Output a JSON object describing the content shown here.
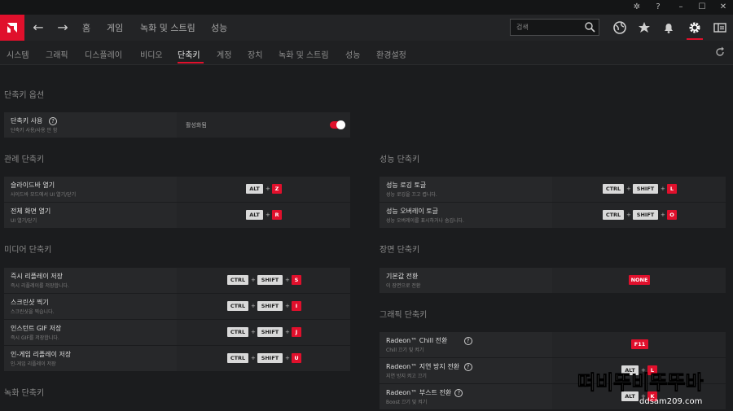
{
  "colors": {
    "accent": "#e0102c",
    "background": "#1b1c1e",
    "row": "#242527"
  },
  "titlebar": {
    "icons": [
      "minimize-icon",
      "help-icon",
      "maximize-icon",
      "close-icon"
    ]
  },
  "topnav": {
    "items": [
      "홈",
      "게임",
      "녹화 및 스트림",
      "성능"
    ],
    "search_placeholder": "검색"
  },
  "subnav": {
    "tabs": [
      "시스템",
      "그래픽",
      "디스플레이",
      "비디오",
      "단축키",
      "계정",
      "장치",
      "녹화 및 스트림",
      "성능",
      "환경설정"
    ],
    "active": "단축키"
  },
  "options": {
    "title": "단축키 옵션",
    "hotkey": {
      "title": "단축키 사용",
      "desc": "단축키 사용/사용 안 함",
      "state": "활성화됨"
    }
  },
  "left_sections": [
    {
      "title": "관례 단축키",
      "rows": [
        {
          "title": "슬라이드바 열기",
          "desc": "사이드바 모드에서 UI 열기/닫기",
          "keys": [
            "ALT",
            "Z"
          ]
        },
        {
          "title": "전체 화면 열기",
          "desc": "UI 열기/닫기",
          "keys": [
            "ALT",
            "R"
          ]
        }
      ]
    },
    {
      "title": "미디어 단축키",
      "rows": [
        {
          "title": "즉시 리플레이 저장",
          "desc": "즉시 리플레이를 저장합니다.",
          "keys": [
            "CTRL",
            "SHIFT",
            "S"
          ]
        },
        {
          "title": "스크린샷 찍기",
          "desc": "스크린샷을 찍습니다.",
          "keys": [
            "CTRL",
            "SHIFT",
            "I"
          ]
        },
        {
          "title": "인스턴트 GIF 저장",
          "desc": "즉시 GIF를 저장합니다.",
          "keys": [
            "CTRL",
            "SHIFT",
            "J"
          ]
        },
        {
          "title": "인-게임 리플레이 저장",
          "desc": "인-게임 리플레이 저장",
          "keys": [
            "CTRL",
            "SHIFT",
            "U"
          ]
        }
      ]
    },
    {
      "title": "녹화 단축키",
      "rows": []
    }
  ],
  "right_sections": [
    {
      "title": "성능 단축키",
      "rows": [
        {
          "title": "성능 로깅 토글",
          "desc": "성능 로깅을 끄고 켭니다.",
          "keys": [
            "CTRL",
            "SHIFT",
            "L"
          ]
        },
        {
          "title": "성능 오버레이 토글",
          "desc": "성능 오버레이를 표시하거나 숨깁니다.",
          "keys": [
            "CTRL",
            "SHIFT",
            "O"
          ]
        }
      ]
    },
    {
      "title": "장면 단축키",
      "rows": [
        {
          "title": "기본값 전환",
          "desc": "이 장면으로 전환",
          "keys": [
            "NONE"
          ]
        }
      ]
    },
    {
      "title": "그래픽 단축키",
      "rows": [
        {
          "title": "Radeon™ Chill 전환",
          "desc": "Chill 끄기 및 켜기",
          "keys": [
            "F11"
          ]
        },
        {
          "title": "Radeon™ 지연 방지 전환",
          "desc": "지연 방지 켜고 끄기",
          "keys": [
            "ALT",
            "L"
          ]
        },
        {
          "title": "Radeon™ 부스트 전환",
          "desc": "Boost 끄기 및 켜기",
          "keys": [
            "ALT",
            "K"
          ]
        }
      ]
    }
  ],
  "watermark": {
    "text": "떠비뚜비뚜뚜바",
    "url": "ddsam209.com"
  }
}
